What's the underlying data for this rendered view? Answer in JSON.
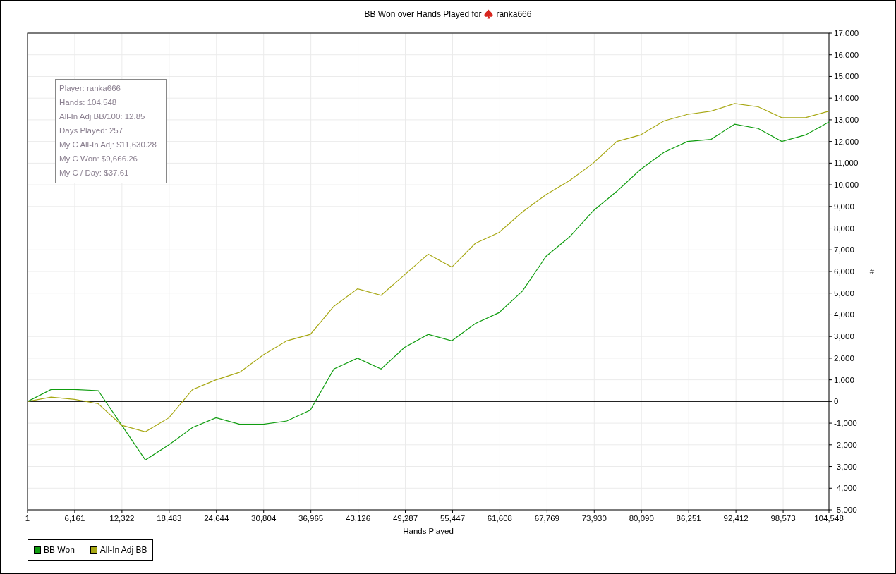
{
  "title": {
    "text": "BB Won over Hands Played for",
    "player": "ranka666"
  },
  "stats": [
    "Player: ranka666",
    "Hands: 104,548",
    "All-In Adj BB/100: 12.85",
    "Days Played: 257",
    "My C All-In Adj: $11,630.28",
    "My C Won: $9,666.26",
    "My C / Day: $37.61"
  ],
  "chart": {
    "chart_data": {
      "type": "line",
      "xlabel": "Hands Played",
      "ylabel": "#",
      "x": [
        1,
        3076,
        6151,
        9226,
        12301,
        15375,
        18450,
        21525,
        24600,
        27675,
        30750,
        33824,
        36899,
        39974,
        43049,
        46124,
        49199,
        52273,
        55348,
        58423,
        61498,
        64573,
        67648,
        70722,
        73797,
        76872,
        79947,
        83022,
        86097,
        89171,
        92246,
        95321,
        98396,
        101471,
        104548
      ],
      "series": [
        {
          "name": "BB Won",
          "color": "#109d10",
          "values": [
            0,
            550,
            550,
            500,
            -1100,
            -2700,
            -2000,
            -1200,
            -750,
            -1050,
            -1050,
            -900,
            -400,
            1500,
            2000,
            1500,
            2500,
            3100,
            2800,
            3600,
            4100,
            5100,
            6700,
            7600,
            8800,
            9700,
            10700,
            11500,
            12000,
            12100,
            12800,
            12600,
            12000,
            12300,
            12900
          ]
        },
        {
          "name": "All-In Adj BB",
          "color": "#a8a814",
          "values": [
            0,
            200,
            100,
            -100,
            -1100,
            -1400,
            -750,
            550,
            1000,
            1350,
            2150,
            2800,
            3100,
            4400,
            5200,
            4900,
            5850,
            6800,
            6200,
            7300,
            7800,
            8750,
            9550,
            10200,
            11000,
            12000,
            12300,
            12950,
            13250,
            13400,
            13750,
            13600,
            13100,
            13100,
            13400
          ]
        }
      ],
      "grid": true,
      "xlim": [
        1,
        104548
      ],
      "ylim": [
        -5000,
        17000
      ],
      "xticks": [
        {
          "value": 1,
          "label": "1"
        },
        {
          "value": 6161,
          "label": "6,161"
        },
        {
          "value": 12322,
          "label": "12,322"
        },
        {
          "value": 18483,
          "label": "18,483"
        },
        {
          "value": 24644,
          "label": "24,644"
        },
        {
          "value": 30804,
          "label": "30,804"
        },
        {
          "value": 36965,
          "label": "36,965"
        },
        {
          "value": 43126,
          "label": "43,126"
        },
        {
          "value": 49287,
          "label": "49,287"
        },
        {
          "value": 55447,
          "label": "55,447"
        },
        {
          "value": 61608,
          "label": "61,608"
        },
        {
          "value": 67769,
          "label": "67,769"
        },
        {
          "value": 73930,
          "label": "73,930"
        },
        {
          "value": 80090,
          "label": "80,090"
        },
        {
          "value": 86251,
          "label": "86,251"
        },
        {
          "value": 92412,
          "label": "92,412"
        },
        {
          "value": 98573,
          "label": "98,573"
        },
        {
          "value": 104548,
          "label": "104,548"
        }
      ],
      "yticks": [
        {
          "value": 17000,
          "label": "17,000"
        },
        {
          "value": 16000,
          "label": "16,000"
        },
        {
          "value": 15000,
          "label": "15,000"
        },
        {
          "value": 14000,
          "label": "14,000"
        },
        {
          "value": 13000,
          "label": "13,000"
        },
        {
          "value": 12000,
          "label": "12,000"
        },
        {
          "value": 11000,
          "label": "11,000"
        },
        {
          "value": 10000,
          "label": "10,000"
        },
        {
          "value": 9000,
          "label": "9,000"
        },
        {
          "value": 8000,
          "label": "8,000"
        },
        {
          "value": 7000,
          "label": "7,000"
        },
        {
          "value": 6000,
          "label": "6,000"
        },
        {
          "value": 5000,
          "label": "5,000"
        },
        {
          "value": 4000,
          "label": "4,000"
        },
        {
          "value": 3000,
          "label": "3,000"
        },
        {
          "value": 2000,
          "label": "2,000"
        },
        {
          "value": 1000,
          "label": "1,000"
        },
        {
          "value": 0,
          "label": "0"
        },
        {
          "value": -1000,
          "label": "-1,000"
        },
        {
          "value": -2000,
          "label": "-2,000"
        },
        {
          "value": -3000,
          "label": "-3,000"
        },
        {
          "value": -4000,
          "label": "-4,000"
        },
        {
          "value": -5000,
          "label": "-5,000"
        }
      ]
    }
  }
}
